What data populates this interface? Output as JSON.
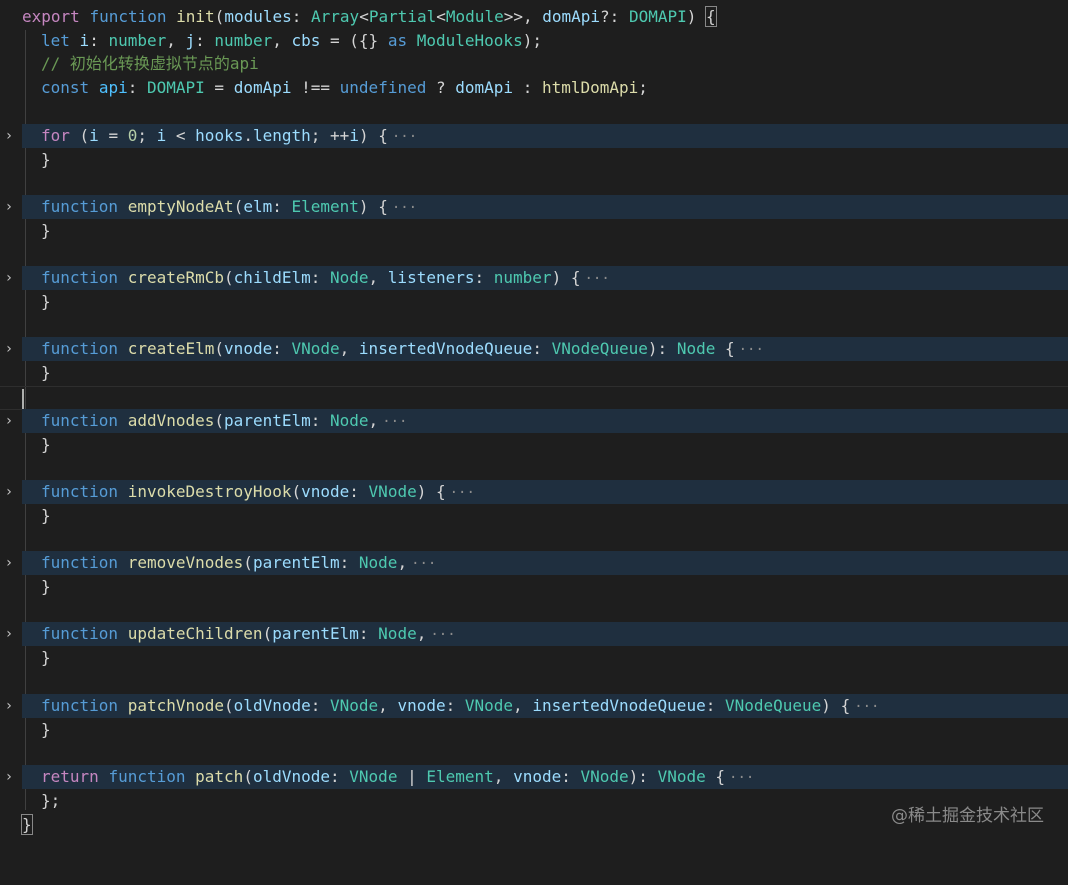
{
  "lines": {
    "l1": [
      "export",
      "function",
      "init",
      "(",
      "modules",
      ": ",
      "Array",
      "<",
      "Partial",
      "<",
      "Module",
      ">>",
      ", ",
      "domApi",
      "?: ",
      "DOMAPI",
      ") ",
      "{"
    ],
    "l2": [
      "let",
      "i",
      ": ",
      "number",
      ", ",
      "j",
      ": ",
      "number",
      ", ",
      "cbs",
      " = ({} ",
      "as",
      "ModuleHooks",
      ");"
    ],
    "l3": "// 初始化转换虚拟节点的api",
    "l4": [
      "const",
      "api",
      ": ",
      "DOMAPI",
      " = ",
      "domApi",
      " !== ",
      "undefined",
      " ? ",
      "domApi",
      " : ",
      "htmlDomApi",
      ";"
    ],
    "l5": [
      "for",
      " (",
      "i",
      " = ",
      "0",
      "; ",
      "i",
      " < ",
      "hooks",
      ".",
      "length",
      "; ++",
      "i",
      ") {"
    ],
    "close": "}",
    "l7": [
      "function",
      "emptyNodeAt",
      "(",
      "elm",
      ": ",
      "Element",
      ") {"
    ],
    "l9": [
      "function",
      "createRmCb",
      "(",
      "childElm",
      ": ",
      "Node",
      ", ",
      "listeners",
      ": ",
      "number",
      ") {"
    ],
    "l11": [
      "function",
      "createElm",
      "(",
      "vnode",
      ": ",
      "VNode",
      ", ",
      "insertedVnodeQueue",
      ": ",
      "VNodeQueue",
      "): ",
      "Node",
      " {"
    ],
    "l13": [
      "function",
      "addVnodes",
      "(",
      "parentElm",
      ": ",
      "Node",
      ","
    ],
    "l15": [
      "function",
      "invokeDestroyHook",
      "(",
      "vnode",
      ": ",
      "VNode",
      ") {"
    ],
    "l17": [
      "function",
      "removeVnodes",
      "(",
      "parentElm",
      ": ",
      "Node",
      ","
    ],
    "l19": [
      "function",
      "updateChildren",
      "(",
      "parentElm",
      ": ",
      "Node",
      ","
    ],
    "l21": [
      "function",
      "patchVnode",
      "(",
      "oldVnode",
      ": ",
      "VNode",
      ", ",
      "vnode",
      ": ",
      "VNode",
      ", ",
      "insertedVnodeQueue",
      ": ",
      "VNodeQueue",
      ") {"
    ],
    "l23": [
      "return",
      "function",
      "patch",
      "(",
      "oldVnode",
      ": ",
      "VNode",
      " | ",
      "Element",
      ", ",
      "vnode",
      ": ",
      "VNode",
      "): ",
      "VNode",
      " {"
    ],
    "l24": "};",
    "l25": "}"
  },
  "ellipsis": "···",
  "fold_chevron": "›",
  "watermark": "@稀土掘金技术社区",
  "colors": {
    "background": "#1e1e1e",
    "keyword": "#569cd6",
    "control": "#c586c0",
    "function": "#dcdcaa",
    "type": "#4ec9b0",
    "variable": "#9cdcfe",
    "comment": "#6a9955",
    "folded_highlight": "#1f2f3f"
  }
}
